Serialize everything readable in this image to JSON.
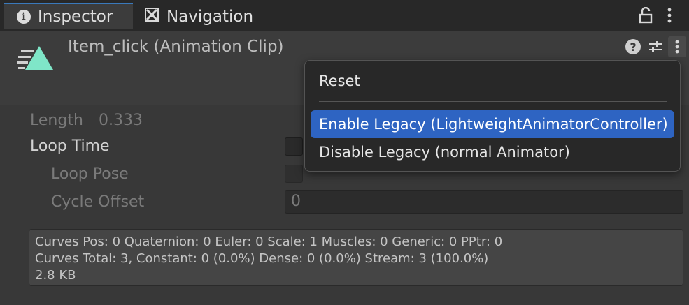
{
  "tabs": [
    {
      "label": "Inspector",
      "icon": "info-icon"
    },
    {
      "label": "Navigation",
      "icon": "navigation-icon"
    }
  ],
  "header": {
    "title": "Item_click (Animation Clip)",
    "help_glyph": "?"
  },
  "info_glyph": "i",
  "fields": {
    "length_label": "Length",
    "length_value": "0.333",
    "loop_time_label": "Loop Time",
    "loop_pose_label": "Loop Pose",
    "cycle_offset_label": "Cycle Offset",
    "cycle_offset_value": "0"
  },
  "info": {
    "line1": "Curves Pos: 0 Quaternion: 0 Euler: 0 Scale: 1 Muscles: 0 Generic: 0 PPtr: 0",
    "line2": "Curves Total: 3, Constant: 0 (0.0%) Dense: 0 (0.0%) Stream: 3 (100.0%)",
    "line3": "2.8 KB"
  },
  "menu": {
    "items": [
      {
        "label": "Reset"
      },
      {
        "label": "Enable Legacy (LightweightAnimatorController)"
      },
      {
        "label": "Disable Legacy (normal Animator)"
      }
    ]
  },
  "colors": {
    "accent": "#2e64c2",
    "clip_icon": "#7fe6c8"
  }
}
